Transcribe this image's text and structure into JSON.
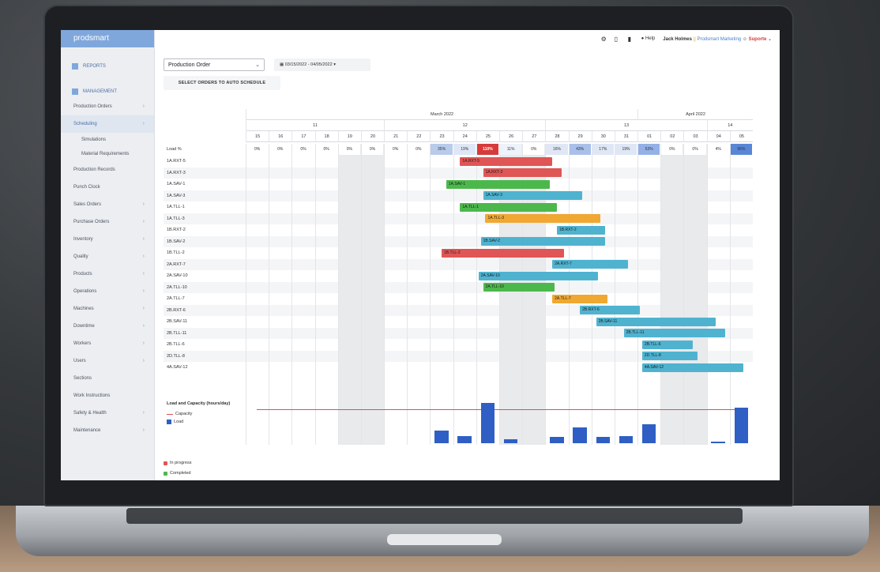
{
  "app": {
    "brand": "prodsmart"
  },
  "sidebar": {
    "items": [
      {
        "label": "REPORTS",
        "type": "section",
        "icon": "reports-icon"
      },
      {
        "label": "MANAGEMENT",
        "type": "section",
        "icon": "management-icon",
        "chevron": true
      },
      {
        "label": "Production Orders",
        "chevron": true
      },
      {
        "label": "Scheduling",
        "chevron": true,
        "active": true
      },
      {
        "label": "Simulations",
        "sub": true
      },
      {
        "label": "Material Requirements",
        "sub": true
      },
      {
        "label": "Production Records"
      },
      {
        "label": "Punch Clock"
      },
      {
        "label": "Sales Orders",
        "chevron": true
      },
      {
        "label": "Purchase Orders",
        "chevron": true
      },
      {
        "label": "Inventory",
        "chevron": true
      },
      {
        "label": "Quality",
        "chevron": true
      },
      {
        "label": "Products",
        "chevron": true
      },
      {
        "label": "Operations",
        "chevron": true
      },
      {
        "label": "Machines",
        "chevron": true
      },
      {
        "label": "Downtime",
        "chevron": true
      },
      {
        "label": "Workers",
        "chevron": true
      },
      {
        "label": "Users",
        "chevron": true
      },
      {
        "label": "Sections"
      },
      {
        "label": "Work Instructions"
      },
      {
        "label": "Safety & Health",
        "chevron": true
      },
      {
        "label": "Maintenance",
        "chevron": true
      }
    ]
  },
  "header": {
    "icons": [
      "gear-icon",
      "phone-icon",
      "bookmark-icon"
    ],
    "help": "Help",
    "user": "Jack Holmes",
    "separator": "||",
    "company": "Prodsmart Marketing",
    "support": "Suporte"
  },
  "toolbar": {
    "order_select": "Production Order",
    "date_range": "03/15/2022 - 04/05/2022",
    "auto_schedule": "SELECT ORDERS TO AUTO SCHEDULE"
  },
  "gantt": {
    "months": [
      {
        "label": "March 2022",
        "start": 0,
        "span": 17
      },
      {
        "label": "April 2022",
        "start": 17,
        "span": 5
      }
    ],
    "weeks": [
      {
        "label": "11",
        "start": 0,
        "span": 6
      },
      {
        "label": "12",
        "start": 6,
        "span": 7
      },
      {
        "label": "13",
        "start": 13,
        "span": 7
      },
      {
        "label": "14",
        "start": 20,
        "span": 2
      }
    ],
    "days": [
      "15",
      "16",
      "17",
      "18",
      "19",
      "20",
      "21",
      "22",
      "23",
      "24",
      "25",
      "26",
      "27",
      "28",
      "29",
      "30",
      "31",
      "01",
      "02",
      "03",
      "04",
      "05"
    ],
    "weekend_days": [
      4,
      5,
      11,
      12,
      18,
      19
    ],
    "load_label": "Load %",
    "load": [
      "0%",
      "0%",
      "0%",
      "0%",
      "0%",
      "0%",
      "0%",
      "0%",
      "35%",
      "19%",
      "110%",
      "11%",
      "0%",
      "16%",
      "43%",
      "17%",
      "19%",
      "53%",
      "0%",
      "0%",
      "4%",
      "96%"
    ],
    "load_colors": [
      "#ffffff",
      "#ffffff",
      "#ffffff",
      "#ffffff",
      "#ffffff",
      "#ffffff",
      "#ffffff",
      "#ffffff",
      "#b9cbeb",
      "#dfe7f6",
      "#d63b3b",
      "#eef2fa",
      "#ffffff",
      "#dfe7f6",
      "#a9c0ea",
      "#dfe7f6",
      "#dfe7f6",
      "#93b1e6",
      "#ffffff",
      "#ffffff",
      "#ffffff",
      "#5a86d6"
    ],
    "rows": [
      {
        "label": "1A.RXT-5",
        "bar": "1A.RXT-5",
        "start": 9.3,
        "end": 13.3,
        "color": "#e05555"
      },
      {
        "label": "1A.RXT-3",
        "bar": "1A.RXT-3",
        "start": 10.3,
        "end": 13.7,
        "color": "#e05555"
      },
      {
        "label": "1A.SAV-1",
        "bar": "1A.SAV-1",
        "start": 8.7,
        "end": 13.2,
        "color": "#4cb84c"
      },
      {
        "label": "1A.SAV-3",
        "bar": "1A.SAV-3",
        "start": 10.3,
        "end": 14.6,
        "color": "#4fb3d0"
      },
      {
        "label": "1A.TLL-1",
        "bar": "1A.TLL-1",
        "start": 9.3,
        "end": 13.5,
        "color": "#4cb84c"
      },
      {
        "label": "1A.TLL-3",
        "bar": "1A.TLL-3",
        "start": 10.4,
        "end": 15.4,
        "color": "#f0a832"
      },
      {
        "label": "1B.RXT-2",
        "bar": "1B.RXT-2",
        "start": 13.5,
        "end": 15.6,
        "color": "#4fb3d0"
      },
      {
        "label": "1B.SAV-2",
        "bar": "1B.SAV-2",
        "start": 10.2,
        "end": 15.6,
        "color": "#4fb3d0"
      },
      {
        "label": "1B.TLL-2",
        "bar": "1B.TLL-2",
        "start": 8.5,
        "end": 13.8,
        "color": "#e05555"
      },
      {
        "label": "2A.RXT-7",
        "bar": "2A.RXT-7",
        "start": 13.3,
        "end": 16.6,
        "color": "#4fb3d0"
      },
      {
        "label": "2A.SAV-10",
        "bar": "2A.SAV-10",
        "start": 10.1,
        "end": 15.3,
        "color": "#4fb3d0"
      },
      {
        "label": "2A.TLL-10",
        "bar": "2A.TLL-10",
        "start": 10.3,
        "end": 13.4,
        "color": "#4cb84c"
      },
      {
        "label": "2A.TLL-7",
        "bar": "2A.TLL-7",
        "start": 13.3,
        "end": 15.7,
        "color": "#f0a832"
      },
      {
        "label": "2B.RXT-6",
        "bar": "2B.RXT-6",
        "start": 14.5,
        "end": 17.1,
        "color": "#4fb3d0"
      },
      {
        "label": "2B.SAV-11",
        "bar": "2B.SAV-11",
        "start": 15.2,
        "end": 20.4,
        "color": "#4fb3d0"
      },
      {
        "label": "2B.TLL-11",
        "bar": "2B.TLL-11",
        "start": 16.4,
        "end": 20.8,
        "color": "#4fb3d0"
      },
      {
        "label": "2B.TLL-6",
        "bar": "2B.TLL-6",
        "start": 17.2,
        "end": 19.4,
        "color": "#4fb3d0"
      },
      {
        "label": "2D.TLL-8",
        "bar": "2D.TLL-8",
        "start": 17.2,
        "end": 19.6,
        "color": "#4fb3d0"
      },
      {
        "label": "4A.SAV-12",
        "bar": "4A.SAV-12",
        "start": 17.2,
        "end": 21.6,
        "color": "#4fb3d0"
      }
    ]
  },
  "chart_data": {
    "type": "bar",
    "title": "Load and Capacity (hours/day)",
    "categories": [
      "15",
      "16",
      "17",
      "18",
      "19",
      "20",
      "21",
      "22",
      "23",
      "24",
      "25",
      "26",
      "27",
      "28",
      "29",
      "30",
      "31",
      "01",
      "02",
      "03",
      "04",
      "05"
    ],
    "series": [
      {
        "name": "Capacity",
        "type": "line",
        "values": [
          8,
          8,
          8,
          8,
          8,
          8,
          8,
          8,
          8,
          8,
          8,
          8,
          8,
          8,
          8,
          8,
          8,
          8,
          8,
          8,
          8,
          8
        ]
      },
      {
        "name": "Load",
        "values": [
          0,
          0,
          0,
          0,
          0,
          0,
          0,
          0,
          2.8,
          1.5,
          8.8,
          0.9,
          0,
          1.3,
          3.4,
          1.4,
          1.5,
          4.2,
          0,
          0,
          0.3,
          7.7
        ]
      }
    ],
    "ylim": [
      0,
      10
    ]
  },
  "status_legend": [
    {
      "label": "In progress",
      "color": "#e05555"
    },
    {
      "label": "Completed",
      "color": "#4cb84c"
    }
  ]
}
